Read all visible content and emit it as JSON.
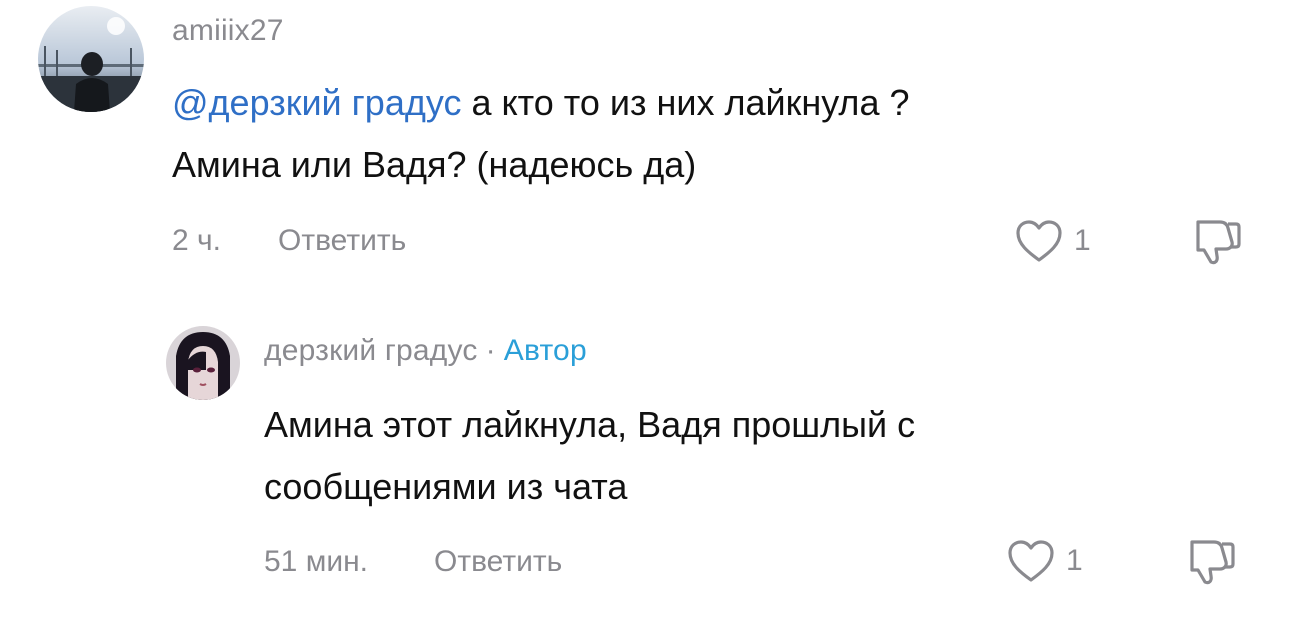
{
  "comments": [
    {
      "username": "amiiix27",
      "mention": "@дерзкий градус",
      "text_line1_rest": " а кто то из них лайкнула ?",
      "text_line2": "Амина или Вадя? (надеюсь да)",
      "time": "2 ч.",
      "reply_label": "Ответить",
      "likes": "1"
    },
    {
      "username": "дерзкий градус",
      "separator": "·",
      "author_badge": "Автор",
      "text_line1": "Амина этот лайкнула, Вадя прошлый с",
      "text_line2": "сообщениями из чата",
      "time": "51 мин.",
      "reply_label": "Ответить",
      "likes": "1"
    }
  ],
  "icons": {
    "like": "heart-outline-icon",
    "dislike": "thumbs-down-outline-icon"
  },
  "colors": {
    "mention": "#2f6fc6",
    "author_badge": "#2a9fd8",
    "meta_gray": "#8a8a8f"
  }
}
